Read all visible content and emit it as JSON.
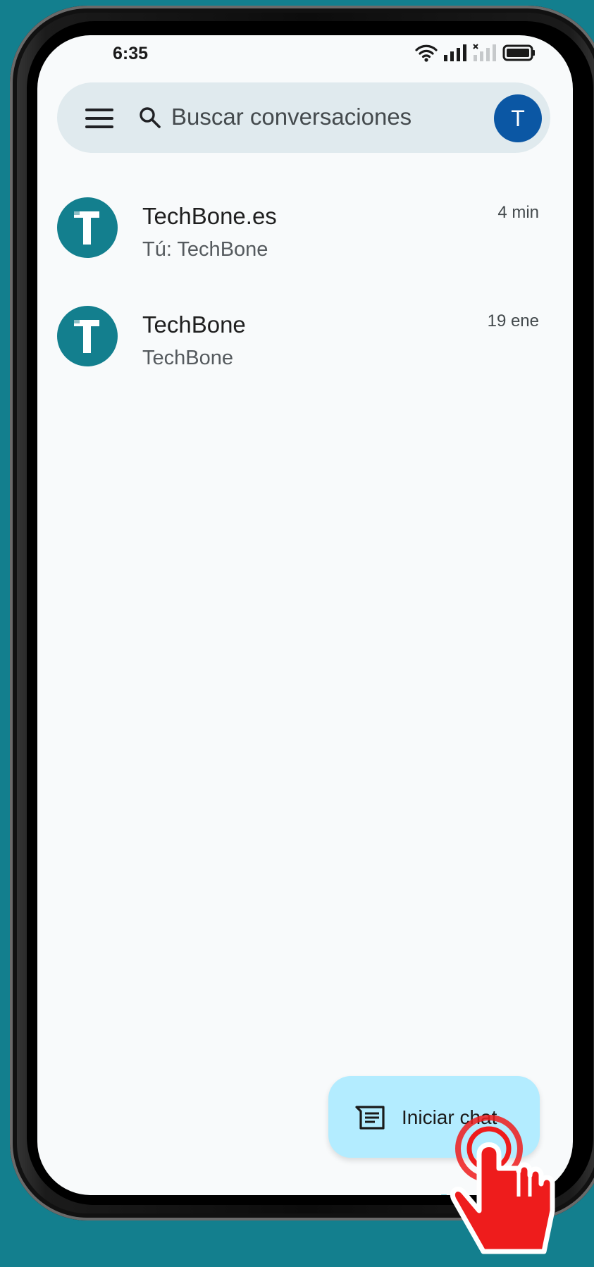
{
  "status_bar": {
    "time": "6:35",
    "icons": [
      "wifi-icon",
      "signal-icon",
      "signal-no-service-icon",
      "battery-icon"
    ]
  },
  "search": {
    "placeholder": "Buscar conversaciones",
    "account_initial": "T"
  },
  "conversations": [
    {
      "name": "TechBone.es",
      "preview": "Tú: TechBone",
      "time": "4 min",
      "avatar_initial": "T"
    },
    {
      "name": "TechBone",
      "preview": "TechBone",
      "time": "19 ene",
      "avatar_initial": "T"
    }
  ],
  "fab": {
    "label": "Iniciar chat",
    "icon": "message-icon"
  },
  "watermark": "TechBone",
  "colors": {
    "background": "#137f8e",
    "screen": "#f8fafb",
    "search_bar": "#e0eaee",
    "account_avatar": "#0b57a4",
    "conversation_avatar": "#137f8e",
    "fab": "#b3ecff",
    "tap_indicator": "#ee1c1c"
  }
}
